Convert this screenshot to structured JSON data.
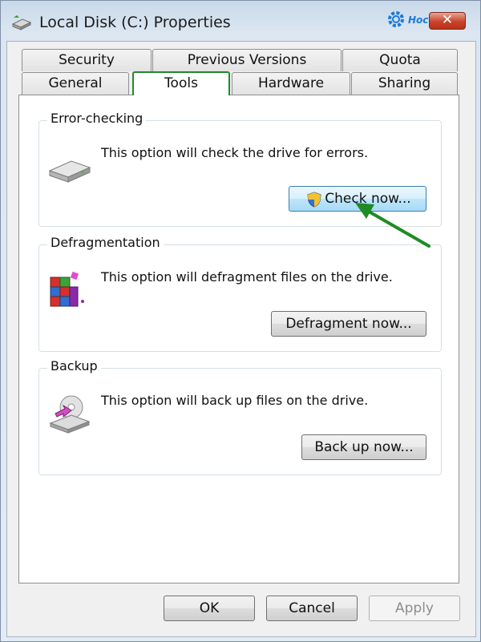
{
  "window": {
    "title": "Local Disk (C:) Properties",
    "close_glyph": "✕"
  },
  "watermark": {
    "text": "Hocviet"
  },
  "tabs": {
    "row1": [
      {
        "label": "Security"
      },
      {
        "label": "Previous Versions"
      },
      {
        "label": "Quota"
      }
    ],
    "row2": [
      {
        "label": "General"
      },
      {
        "label": "Tools",
        "active": true
      },
      {
        "label": "Hardware"
      },
      {
        "label": "Sharing"
      }
    ]
  },
  "error_checking": {
    "title": "Error-checking",
    "description": "This option will check the drive for errors.",
    "button": "Check now...",
    "icon": "hard-drive-icon"
  },
  "defragmentation": {
    "title": "Defragmentation",
    "description": "This option will defragment files on the drive.",
    "button": "Defragment now...",
    "icon": "defragment-icon"
  },
  "backup": {
    "title": "Backup",
    "description": "This option will back up files on the drive.",
    "button": "Back up now...",
    "icon": "backup-icon"
  },
  "footer": {
    "ok": "OK",
    "cancel": "Cancel",
    "apply": "Apply"
  },
  "colors": {
    "active_tab_border": "#1f8b25",
    "annotation_arrow": "#1f8b25",
    "close_button": "#c9442b"
  }
}
